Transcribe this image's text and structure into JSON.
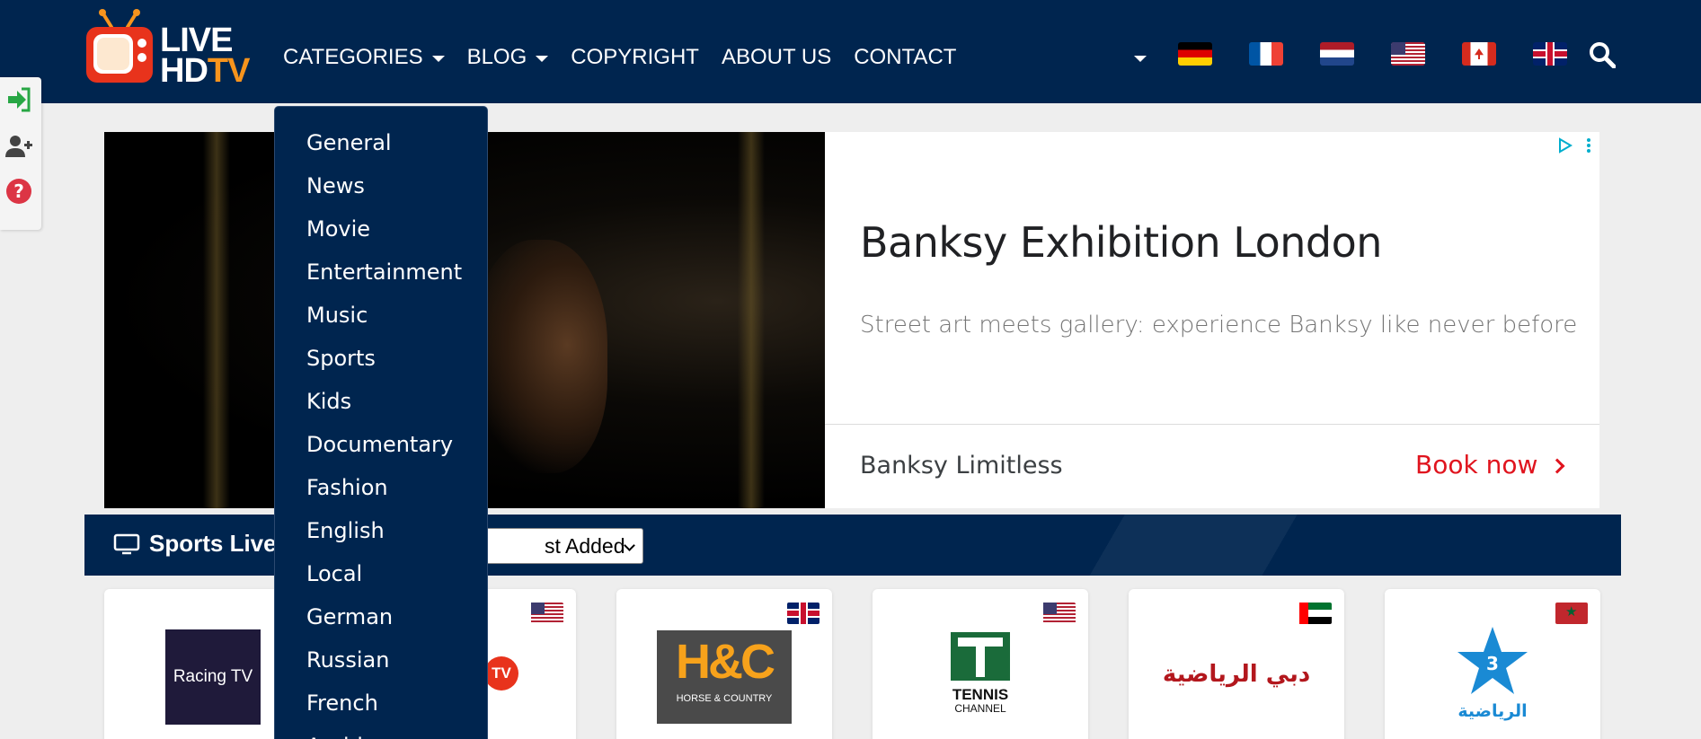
{
  "header": {
    "logo": {
      "line1": "LIVE",
      "line2_a": "HD",
      "line2_b": "TV"
    },
    "nav": [
      {
        "label": "CATEGORIES",
        "has_caret": true
      },
      {
        "label": "BLOG",
        "has_caret": true
      },
      {
        "label": "COPYRIGHT",
        "has_caret": false
      },
      {
        "label": "ABOUT US",
        "has_caret": false
      },
      {
        "label": "CONTACT",
        "has_caret": false
      }
    ],
    "languages": [
      "Germany",
      "France",
      "Netherlands",
      "United States",
      "Canada",
      "United Kingdom"
    ],
    "search_icon": "search-icon"
  },
  "side_tools": [
    "sign-in-icon",
    "user-plus-icon",
    "help-icon"
  ],
  "categories_menu": [
    "General",
    "News",
    "Movie",
    "Entertainment",
    "Music",
    "Sports",
    "Kids",
    "Documentary",
    "Fashion",
    "English",
    "Local",
    "German",
    "Russian",
    "French",
    "Arabic"
  ],
  "ad": {
    "title": "Banksy Exhibition London",
    "description": "Street art meets gallery: experience Banksy like never before",
    "advertiser": "Banksy Limitless",
    "cta": "Book now"
  },
  "section": {
    "title": "Sports Live",
    "sort_value": "st Added"
  },
  "channels": [
    {
      "name": "Racing TV",
      "flag": "us"
    },
    {
      "name": "TV",
      "flag": "us"
    },
    {
      "name": "H&C",
      "subtitle": "HORSE & COUNTRY",
      "flag": "uk"
    },
    {
      "name": "TENNIS",
      "subtitle": "CHANNEL",
      "flag": "us"
    },
    {
      "name": "دبي الرياضية",
      "flag": "ae"
    },
    {
      "name": "الرياضية",
      "flag": "ma"
    }
  ],
  "colors": {
    "navy": "#00254f",
    "accent_orange": "#f7941d",
    "cta_red": "#e0141e"
  }
}
